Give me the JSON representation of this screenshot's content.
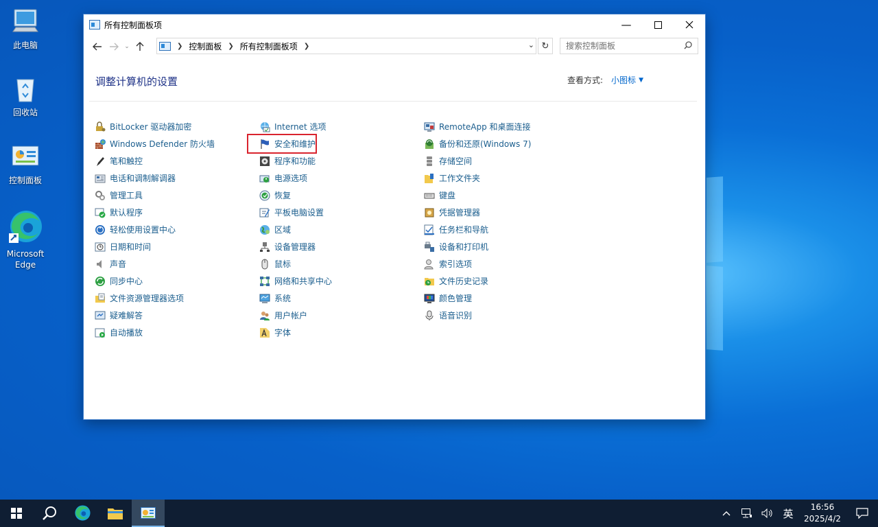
{
  "desktop": {
    "icons": [
      {
        "label": "此电脑"
      },
      {
        "label": "回收站"
      },
      {
        "label": "控制面板"
      },
      {
        "label": "Microsoft Edge"
      }
    ]
  },
  "window": {
    "title": "所有控制面板项",
    "breadcrumb": [
      "控制面板",
      "所有控制面板项"
    ],
    "search_placeholder": "搜索控制面板",
    "heading": "调整计算机的设置",
    "view_by_label": "查看方式:",
    "view_by_value": "小图标",
    "columns": [
      [
        "BitLocker 驱动器加密",
        "Windows Defender 防火墙",
        "笔和触控",
        "电话和调制解调器",
        "管理工具",
        "默认程序",
        "轻松使用设置中心",
        "日期和时间",
        "声音",
        "同步中心",
        "文件资源管理器选项",
        "疑难解答",
        "自动播放"
      ],
      [
        "Internet 选项",
        "安全和维护",
        "程序和功能",
        "电源选项",
        "恢复",
        "平板电脑设置",
        "区域",
        "设备管理器",
        "鼠标",
        "网络和共享中心",
        "系统",
        "用户帐户",
        "字体"
      ],
      [
        "RemoteApp 和桌面连接",
        "备份和还原(Windows 7)",
        "存储空间",
        "工作文件夹",
        "键盘",
        "凭据管理器",
        "任务栏和导航",
        "设备和打印机",
        "索引选项",
        "文件历史记录",
        "颜色管理",
        "语音识别"
      ]
    ],
    "highlighted_item": "安全和维护"
  },
  "taskbar": {
    "ime": "英",
    "time": "16:56",
    "date": "2025/4/2"
  },
  "colors": {
    "link": "#1b5e8e",
    "heading": "#1e3287",
    "highlight_border": "#d9232d",
    "taskbar": "#0f1e33"
  }
}
